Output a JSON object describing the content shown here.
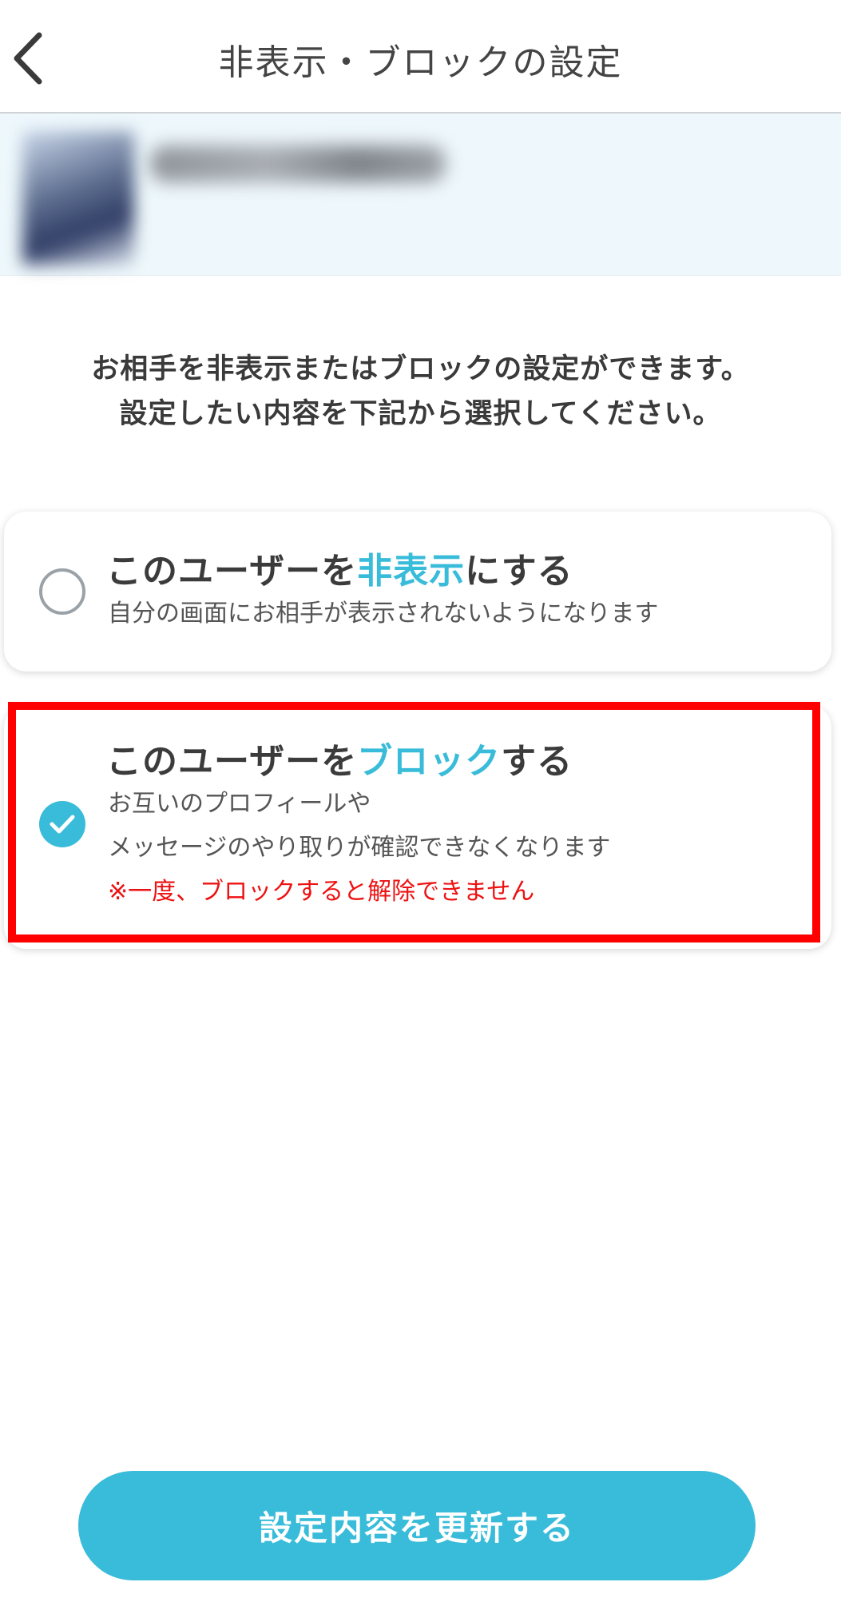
{
  "header": {
    "back_icon": "chevron-left-icon",
    "title": "非表示・ブロックの設定"
  },
  "profile": {
    "avatar": "blurred-avatar",
    "name": "[blurred]"
  },
  "description": {
    "line1": "お相手を非表示またはブロックの設定ができます。",
    "line2": "設定したい内容を下記から選択してください。"
  },
  "options": [
    {
      "id": "hide",
      "selected": false,
      "title_prefix": "このユーザーを",
      "title_accent": "非表示",
      "title_suffix": "にする",
      "desc": [
        "自分の画面にお相手が表示されないようになります"
      ]
    },
    {
      "id": "block",
      "selected": true,
      "title_prefix": "このユーザーを",
      "title_accent": "ブロック",
      "title_suffix": "する",
      "desc": [
        "お互いのプロフィールや",
        "メッセージのやり取りが確認できなくなります"
      ],
      "warning": "※一度、ブロックすると解除できません"
    }
  ],
  "submit": {
    "label": "設定内容を更新する"
  },
  "colors": {
    "accent": "#38bcd9",
    "warning": "#ee1111",
    "highlight": "#ff0000"
  }
}
